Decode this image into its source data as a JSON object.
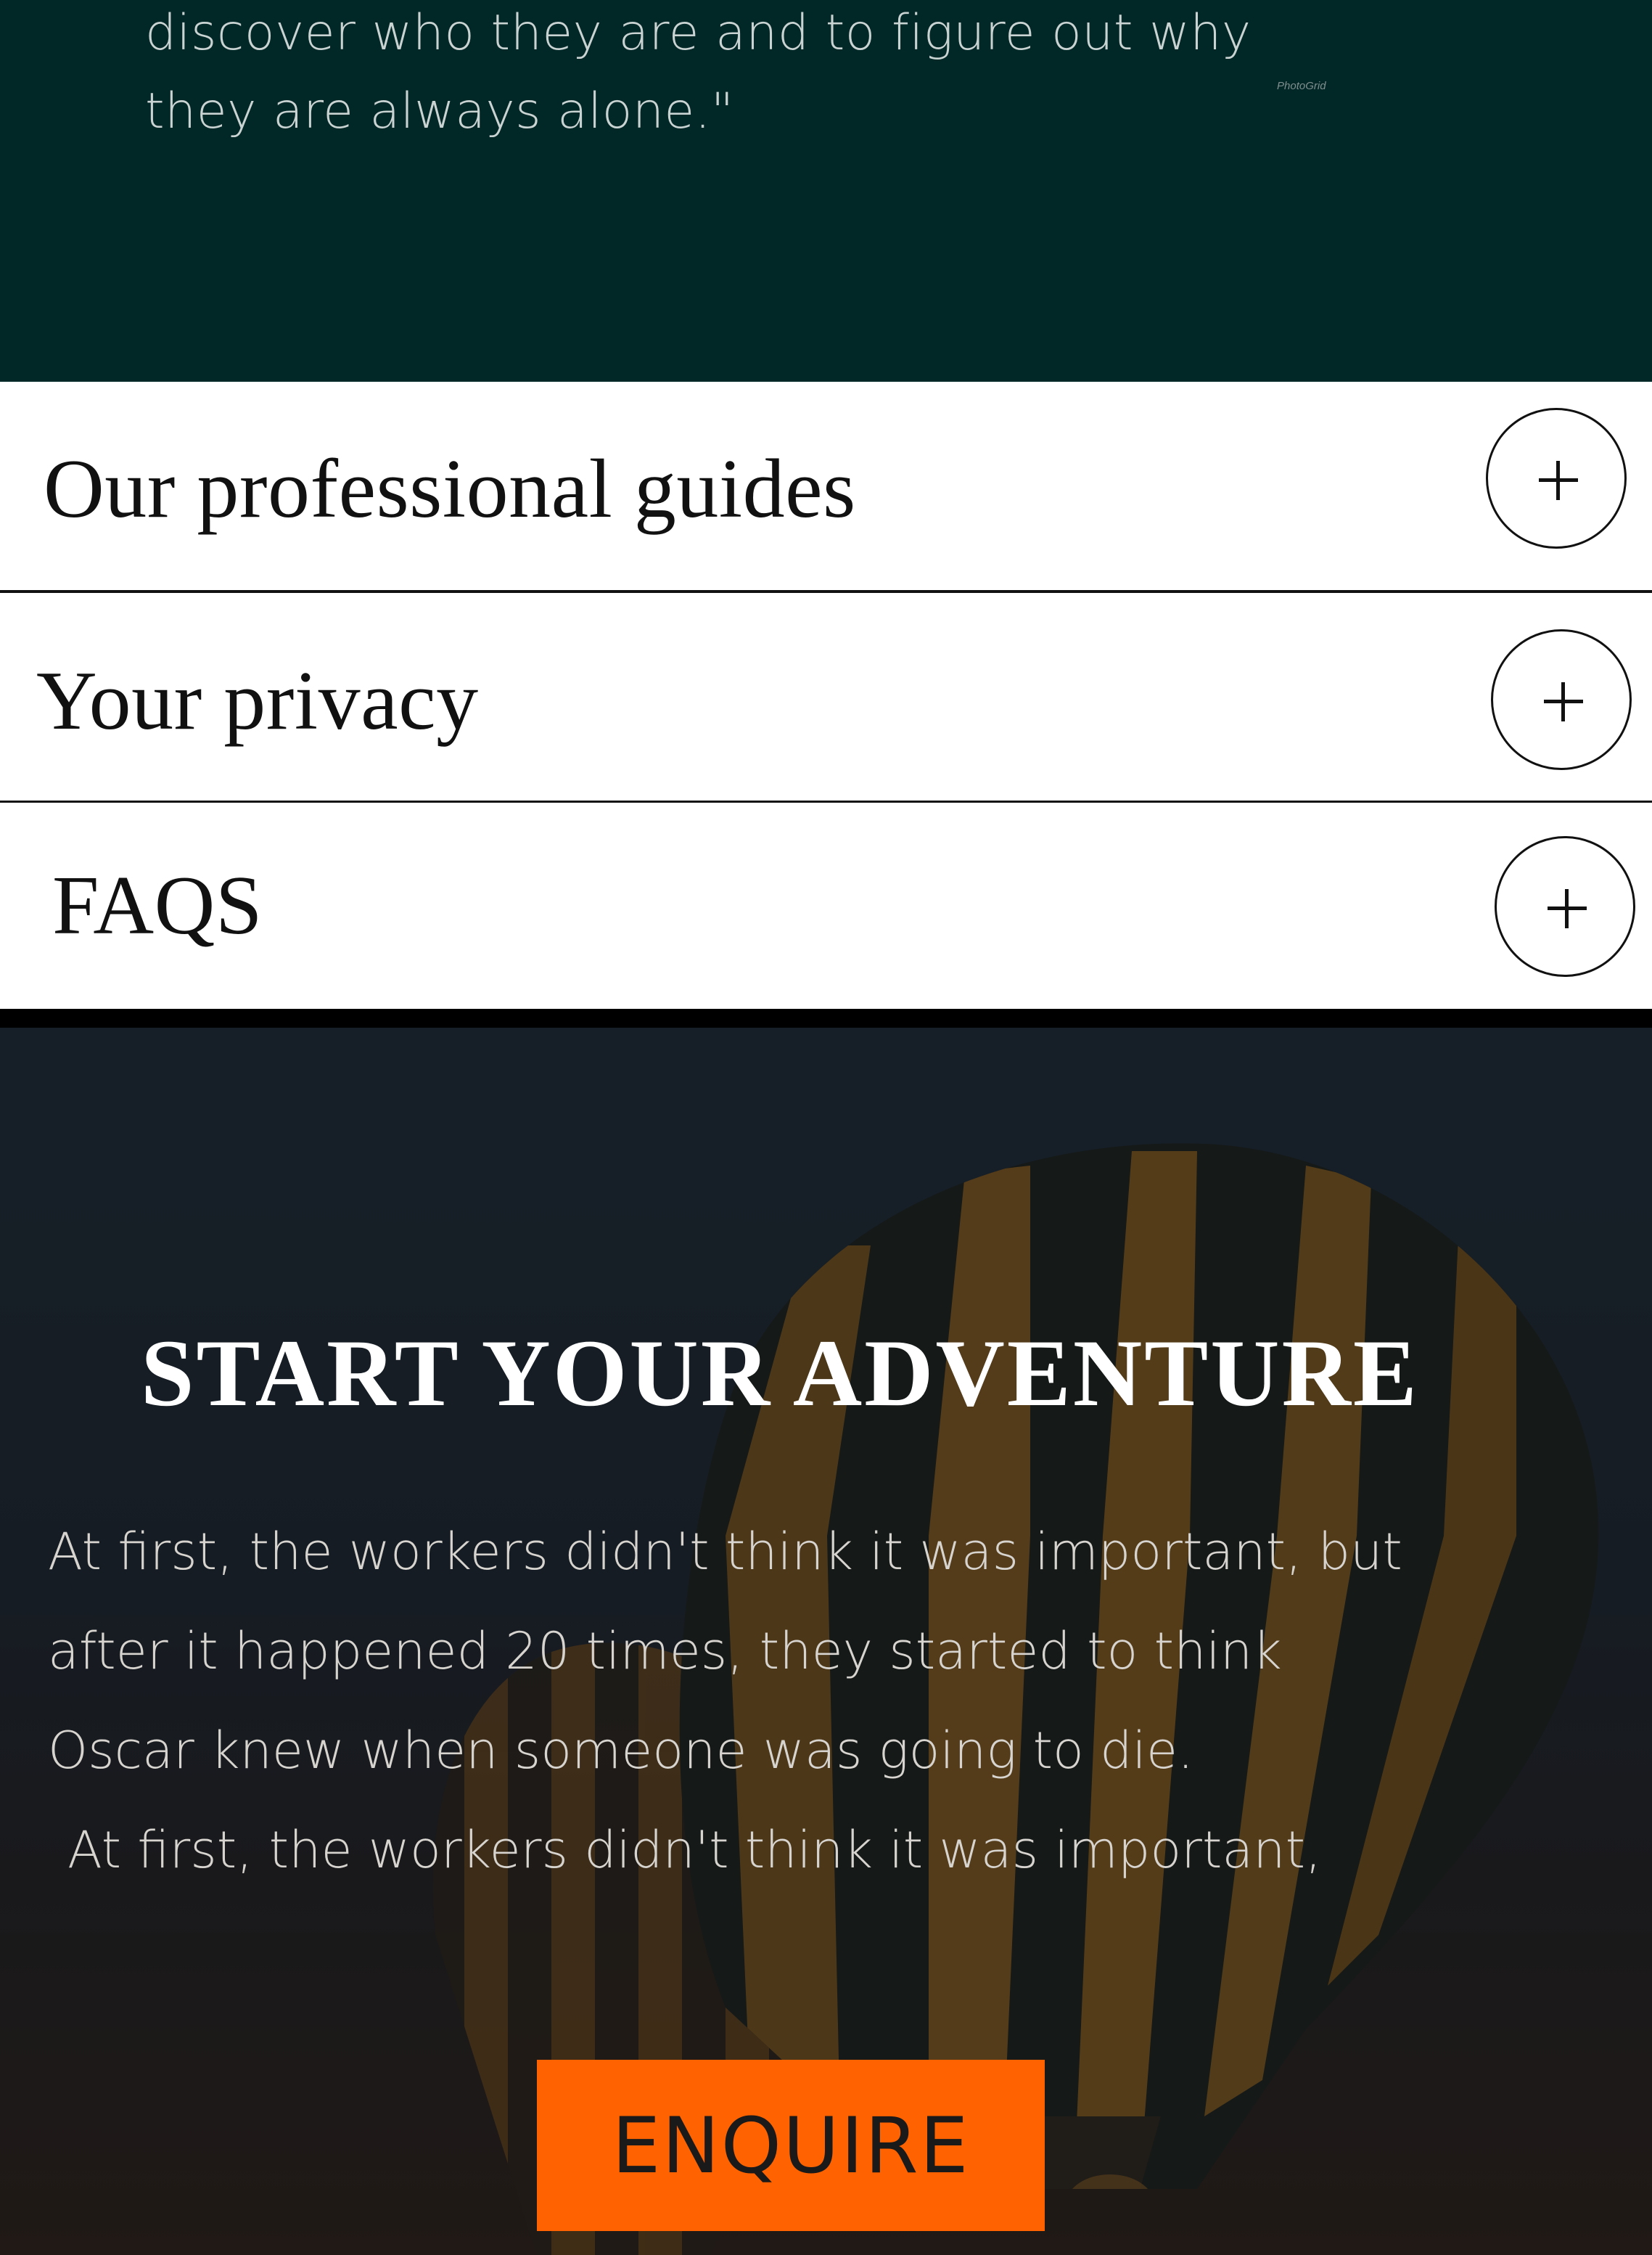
{
  "quote": {
    "lines": [
      "discover who they are and to figure out why",
      "they are always alone.\""
    ],
    "watermark": "PhotoGrid"
  },
  "accordion": {
    "items": [
      {
        "label": "Our professional guides",
        "icon": "plus-icon",
        "expanded": false
      },
      {
        "label": "Your privacy",
        "icon": "plus-icon",
        "expanded": false
      },
      {
        "label": "FAQS",
        "icon": "plus-icon",
        "expanded": false
      }
    ]
  },
  "adventure": {
    "title": "START YOUR ADVENTURE",
    "body_lines": [
      "At first, the workers didn't think it was important, but",
      "after it happened 20 times, they started to think",
      "Oscar knew when someone was going to die.",
      "At first, the workers didn't think it was important,"
    ],
    "cta_label": "ENQUIRE",
    "background_image": "hot-air-balloons-at-dusk"
  },
  "colors": {
    "quote_band": "#022727",
    "cta": "#ff6200",
    "text_dark": "#111111"
  }
}
